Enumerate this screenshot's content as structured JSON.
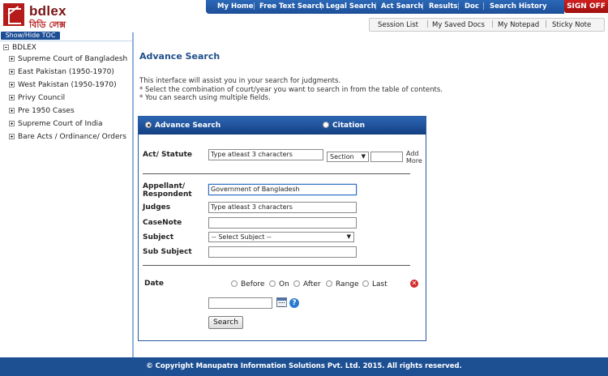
{
  "brand": {
    "name": "bdlex",
    "name_bn": "বিডি লেক্স"
  },
  "nav": {
    "items": [
      "My Home",
      "Free Text Search",
      "Legal Search",
      "Act Search",
      "Results",
      "Doc",
      "Search History"
    ],
    "signoff": "SIGN OFF"
  },
  "subnav": {
    "items": [
      "Session List",
      "My Saved Docs",
      "My Notepad",
      "Sticky Note"
    ]
  },
  "toc": {
    "toggle": "Show/Hide TOC",
    "root": "BDLEX",
    "items": [
      "Supreme Court of Bangladesh",
      "East Pakistan (1950-1970)",
      "West Pakistan (1950-1970)",
      "Privy Council",
      "Pre 1950 Cases",
      "Supreme Court of India",
      "Bare Acts / Ordinance/ Orders"
    ]
  },
  "main": {
    "title": "Advance Search",
    "intro": [
      "This interface will assist you in your search for judgments.",
      "* Select the combination of court/year you want to search in from the table of contents.",
      "* You can search using multiple fields."
    ]
  },
  "form": {
    "tabs": {
      "advance": "Advance Search",
      "citation": "Citation"
    },
    "act_label": "Act/ Statute",
    "act_value": "Type atleast 3 characters",
    "section_select": "Section",
    "add_more": [
      "Add",
      "More"
    ],
    "appellant_label": [
      "Appellant/",
      "Respondent"
    ],
    "appellant_value": "Government of Bangladesh",
    "judges_label": "Judges",
    "judges_value": "Type atleast 3 characters",
    "casenote_label": "CaseNote",
    "subject_label": "Subject",
    "subject_select": "-- Select Subject --",
    "subsubject_label": "Sub Subject",
    "date_label": "Date",
    "date_options": [
      "Before",
      "On",
      "After",
      "Range",
      "Last"
    ],
    "search_button": "Search"
  },
  "footer": {
    "text": "© Copyright Manupatra Information Solutions Pvt. Ltd. 2015. All rights reserved."
  }
}
